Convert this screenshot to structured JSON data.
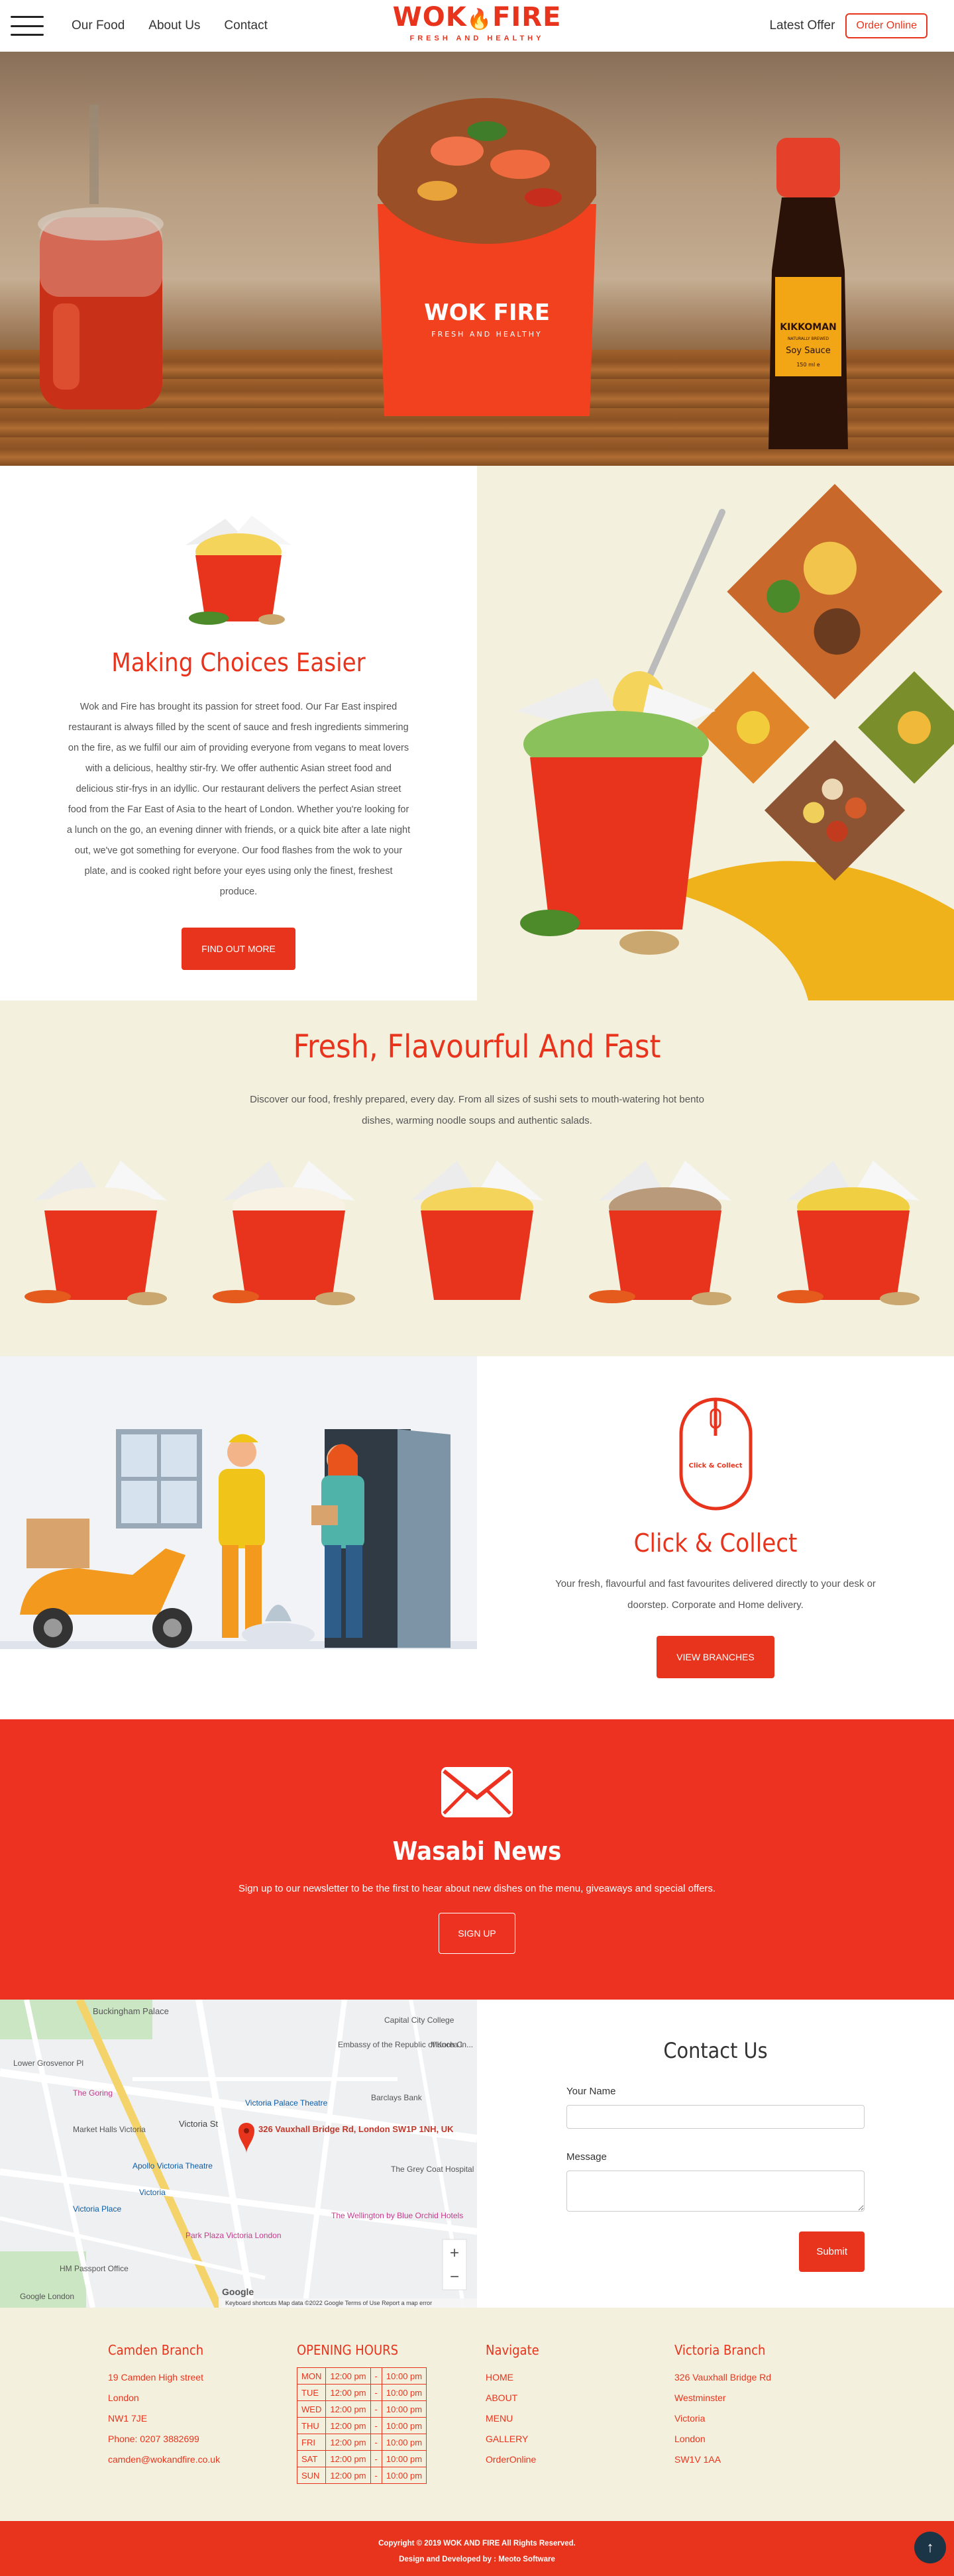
{
  "header": {
    "nav": [
      "Our Food",
      "About Us",
      "Contact"
    ],
    "logo_text": "WOK",
    "logo_text2": "FIRE",
    "logo_tagline": "FRESH AND HEALTHY",
    "latest_offer": "Latest Offer",
    "order_online": "Order Online"
  },
  "hero": {
    "box_logo_text": "WOK FIRE",
    "box_logo_tag": "FRESH AND HEALTHY",
    "bottle_brand": "KIKKOMAN",
    "bottle_sub": "NATURALLY BREWED",
    "bottle_label": "Soy Sauce",
    "bottle_size": "150 ml e"
  },
  "about": {
    "title": "Making Choices Easier",
    "text": "Wok and Fire has brought its passion for street food. Our Far East inspired restaurant is always filled by the scent of sauce and fresh ingredients simmering on the fire, as we fulfil our aim of providing everyone from vegans to meat lovers with a delicious, healthy stir-fry. We offer authentic Asian street food and delicious stir-frys in an idyllic. Our restaurant delivers the perfect Asian street food from the Far East of Asia to the heart of London. Whether you're looking for a lunch on the go, an evening dinner with friends, or a quick bite after a late night out, we've got something for everyone. Our food flashes from the wok to your plate, and is cooked right before your eyes using only the finest, freshest produce.",
    "button": "Find Out More"
  },
  "fresh": {
    "title": "Fresh, Flavourful And Fast",
    "text": "Discover our food, freshly prepared, every day. From all sizes of sushi sets to mouth-watering hot bento dishes, warming noodle soups and authentic salads."
  },
  "collect": {
    "icon_text": "Click & Collect",
    "title": "Click & Collect",
    "text": "Your fresh, flavourful and fast favourites delivered directly to your desk or doorstep. Corporate and Home delivery.",
    "button": "View Branches"
  },
  "newsletter": {
    "title": "Wasabi News",
    "text": "Sign up to our newsletter to be the first to hear about new dishes on the menu, giveaways and special offers.",
    "button": "Sign Up"
  },
  "map": {
    "pin_address": "326 Vauxhall Bridge Rd, London SW1P 1NH, UK",
    "labels": [
      "Buckingham Palace",
      "Lower Grosvenor Pl",
      "The Goring",
      "Victoria Palace Theatre",
      "Market Halls Victoria",
      "Victoria St",
      "Apollo Victoria Theatre",
      "Victoria",
      "Victoria Place",
      "Park Plaza Victoria London",
      "HM Passport Office",
      "The Grey Coat Hospital",
      "The Wellington by Blue Orchid Hotels",
      "Barclays Bank",
      "Embassy of the Republic of Korea in...",
      "Munch C",
      "Google London",
      "Capital City College"
    ],
    "footer": "Keyboard shortcuts   Map data ©2022 Google   Terms of Use   Report a map error",
    "google": "Google",
    "zoom_in": "+",
    "zoom_out": "−"
  },
  "contact": {
    "title": "Contact Us",
    "name_label": "Your Name",
    "message_label": "Message",
    "submit": "Submit"
  },
  "footer": {
    "camden": {
      "title": "Camden Branch",
      "lines": [
        "19 Camden High street",
        "London",
        "NW1 7JE",
        "Phone: 0207 3882699",
        "camden@wokandfire.co.uk"
      ]
    },
    "hours": {
      "title": "OPENING HOURS",
      "rows": [
        {
          "day": "MON",
          "open": "12:00 pm",
          "sep": "-",
          "close": "10:00 pm"
        },
        {
          "day": "TUE",
          "open": "12:00 pm",
          "sep": "-",
          "close": "10:00 pm"
        },
        {
          "day": "WED",
          "open": "12:00 pm",
          "sep": "-",
          "close": "10:00 pm"
        },
        {
          "day": "THU",
          "open": "12:00 pm",
          "sep": "-",
          "close": "10:00 pm"
        },
        {
          "day": "FRI",
          "open": "12:00 pm",
          "sep": "-",
          "close": "10:00 pm"
        },
        {
          "day": "SAT",
          "open": "12:00 pm",
          "sep": "-",
          "close": "10:00 pm"
        },
        {
          "day": "SUN",
          "open": "12:00 pm",
          "sep": "-",
          "close": "10:00 pm"
        }
      ]
    },
    "navigate": {
      "title": "Navigate",
      "links": [
        "HOME",
        "ABOUT",
        "MENU",
        "GALLERY",
        "OrderOnline"
      ]
    },
    "victoria": {
      "title": "Victoria Branch",
      "lines": [
        "326 Vauxhall Bridge Rd",
        "Westminster",
        "Victoria",
        "London",
        "SW1V 1AA"
      ]
    }
  },
  "copyright": {
    "line1": "Copyright © 2019 WOK AND FIRE All Rights Reserved.",
    "line2": "Design and Developed by : Meoto Software"
  },
  "to_top_icon": "arrow-up-icon",
  "colors": {
    "brand_red": "#e8341c",
    "news_red": "#ee3222",
    "cream": "#f4f0de",
    "navy": "#1b3446"
  }
}
